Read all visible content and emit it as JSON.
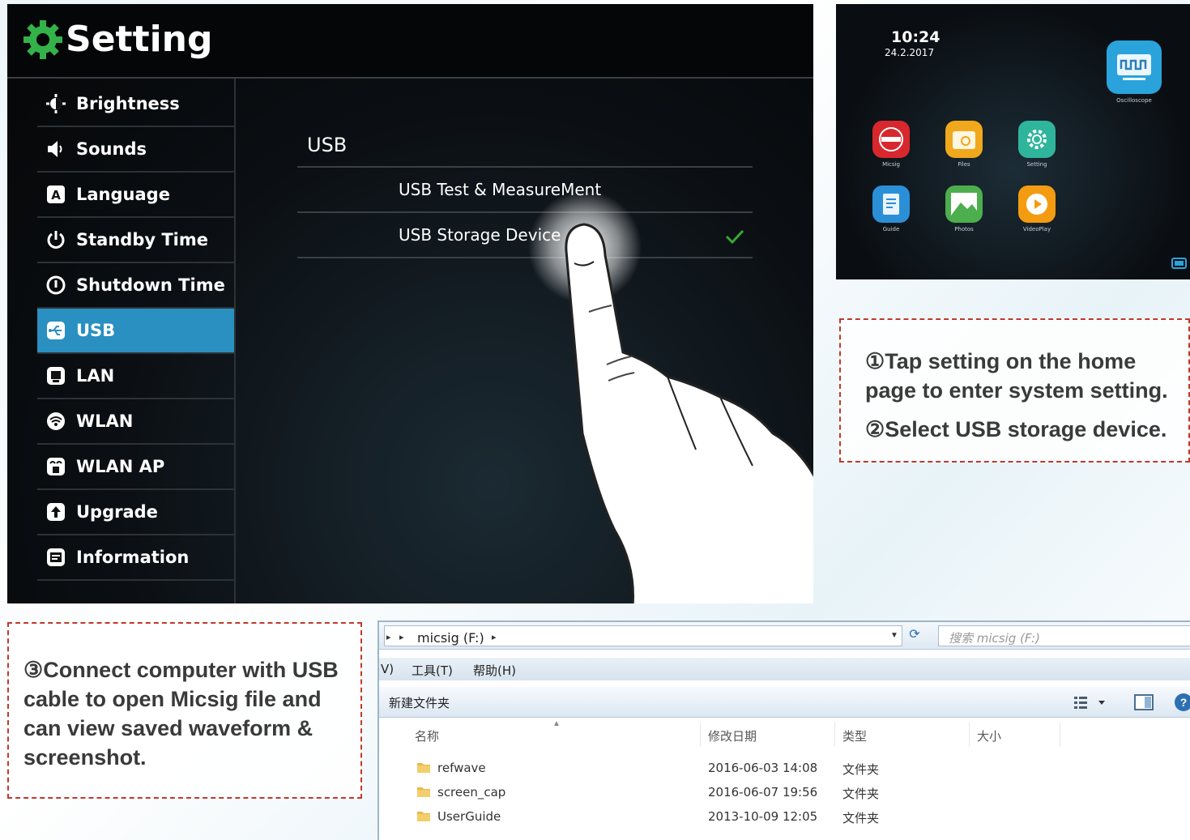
{
  "setting_screen": {
    "title": "Setting",
    "menu": [
      {
        "label": "Brightness",
        "icon": "brightness-icon",
        "active": false
      },
      {
        "label": "Sounds",
        "icon": "speaker-icon",
        "active": false
      },
      {
        "label": "Language",
        "icon": "language-icon",
        "active": false
      },
      {
        "label": "Standby Time",
        "icon": "power-icon",
        "active": false
      },
      {
        "label": "Shutdown Time",
        "icon": "shutdown-icon",
        "active": false
      },
      {
        "label": "USB",
        "icon": "usb-icon",
        "active": true
      },
      {
        "label": "LAN",
        "icon": "lan-icon",
        "active": false
      },
      {
        "label": "WLAN",
        "icon": "wifi-icon",
        "active": false
      },
      {
        "label": "WLAN AP",
        "icon": "wlan-ap-icon",
        "active": false
      },
      {
        "label": "Upgrade",
        "icon": "upgrade-icon",
        "active": false
      },
      {
        "label": "Information",
        "icon": "information-icon",
        "active": false
      }
    ],
    "usb": {
      "title": "USB",
      "options": [
        {
          "label": "USB Test & MeasureMent",
          "selected": false
        },
        {
          "label": "USB Storage Device",
          "selected": true
        }
      ]
    },
    "colors": {
      "active": "#2a8fc1",
      "gear": "#33b24a",
      "check": "#38a832"
    }
  },
  "home_screen": {
    "time": "10:24",
    "date": "24.2.2017",
    "apps": [
      {
        "label": "Oscilloscope",
        "icon": "oscilloscope-icon",
        "color": "#2aa3dc"
      },
      {
        "label": "Micsig",
        "icon": "micsig-logo-icon",
        "color": "#d8282d"
      },
      {
        "label": "Files",
        "icon": "files-icon",
        "color": "#f0a81c"
      },
      {
        "label": "Setting",
        "icon": "gear-icon",
        "color": "#2fb59c"
      },
      {
        "label": "Guide",
        "icon": "guide-icon",
        "color": "#2b8fd8"
      },
      {
        "label": "Photos",
        "icon": "photos-icon",
        "color": "#4cae4c"
      },
      {
        "label": "VideoPlay",
        "icon": "play-icon",
        "color": "#f39c12"
      }
    ]
  },
  "instructions": {
    "step1_line1": "①Tap setting on the home",
    "step1_line2": "page to enter system setting.",
    "step2": "②Select USB storage device.",
    "step3_line1": "③Connect computer with USB",
    "step3_line2": "cable to open Micsig file and",
    "step3_line3": "can view saved waveform &",
    "step3_line4": "screenshot."
  },
  "explorer": {
    "address": "micsig (F:)",
    "search_placeholder": "搜索 micsig (F:)",
    "menu": [
      "V)",
      "工具(T)",
      "帮助(H)"
    ],
    "toolbar_new_folder": "新建文件夹",
    "columns": [
      "名称",
      "修改日期",
      "类型",
      "大小"
    ],
    "files": [
      {
        "name": "refwave",
        "modified": "2016-06-03  14:08",
        "type": "文件夹"
      },
      {
        "name": "screen_cap",
        "modified": "2016-06-07  19:56",
        "type": "文件夹"
      },
      {
        "name": "UserGuide",
        "modified": "2013-10-09  12:05",
        "type": "文件夹"
      }
    ]
  }
}
